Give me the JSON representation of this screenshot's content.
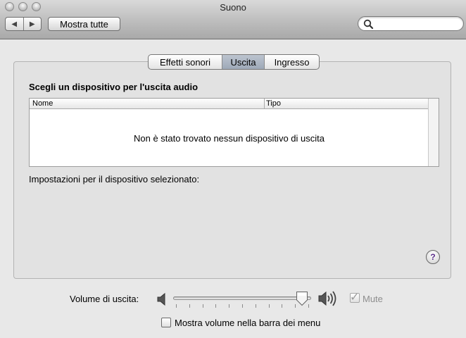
{
  "window": {
    "title": "Suono"
  },
  "toolbar": {
    "back_icon": "◀",
    "forward_icon": "▶",
    "show_all_label": "Mostra tutte",
    "search": {
      "value": "",
      "placeholder": ""
    }
  },
  "tabs": [
    {
      "label": "Effetti sonori",
      "selected": false
    },
    {
      "label": "Uscita",
      "selected": true
    },
    {
      "label": "Ingresso",
      "selected": false
    }
  ],
  "output": {
    "section_title": "Scegli un dispositivo per l'uscita audio",
    "table": {
      "columns": [
        "Nome",
        "Tipo"
      ],
      "rows": [],
      "empty_message": "Non è stato trovato nessun dispositivo di uscita"
    },
    "selected_device_settings_label": "Impostazioni per il dispositivo selezionato:",
    "help_label": "?"
  },
  "volume": {
    "label": "Volume di uscita:",
    "level": 0.95,
    "mute_label": "Mute",
    "mute_checked": true,
    "mute_enabled": false,
    "show_in_menubar_label": "Mostra volume nella barra dei menu",
    "show_in_menubar_checked": false
  },
  "colors": {
    "selected_tab": "#a9b3c1",
    "help_glyph": "#5b2d8a"
  }
}
